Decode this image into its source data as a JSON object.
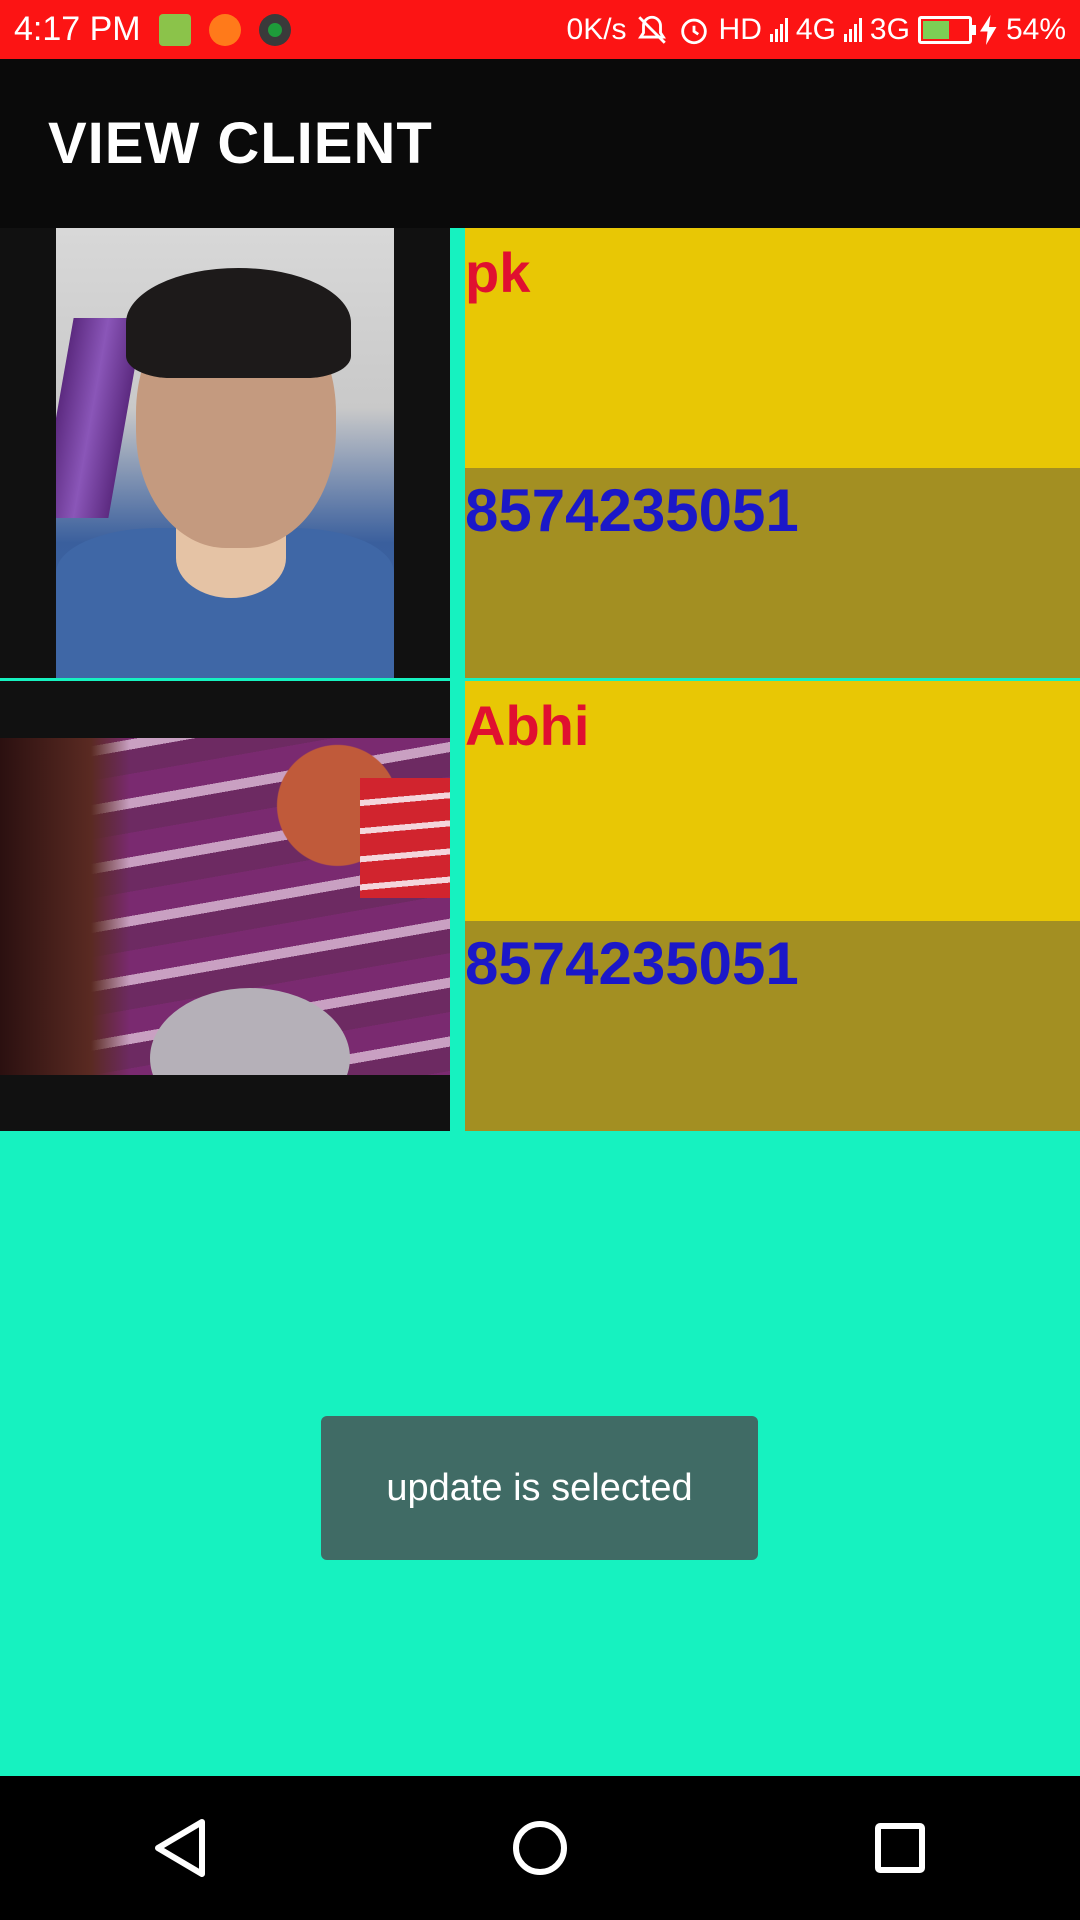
{
  "status_bar": {
    "time": "4:17 PM",
    "net_speed": "0K/s",
    "hd_label": "HD",
    "network_4g": "4G",
    "network_3g": "3G",
    "battery_percent": "54%",
    "battery_level": 0.54,
    "icons": [
      "store-icon",
      "crop-icon",
      "phone-call-icon",
      "mute-icon",
      "alarm-icon",
      "signal-icon",
      "battery-icon",
      "charging-icon"
    ]
  },
  "app_bar": {
    "title": "VIEW CLIENT"
  },
  "clients": [
    {
      "name": "pk",
      "phone": "8574235051"
    },
    {
      "name": "Abhi",
      "phone": "8574235051"
    }
  ],
  "toast": {
    "message": "update is selected"
  },
  "nav_bar": {
    "icons": [
      "back-icon",
      "home-icon",
      "recents-icon"
    ]
  },
  "colors": {
    "status_bar": "#fc1414",
    "app_bar": "#0a0a0a",
    "background": "#16f2c0",
    "name_cell": "#e8c705",
    "phone_cell": "#a38f22",
    "name_text": "#e01030",
    "phone_text": "#1b18c8",
    "toast": "#406b65"
  }
}
